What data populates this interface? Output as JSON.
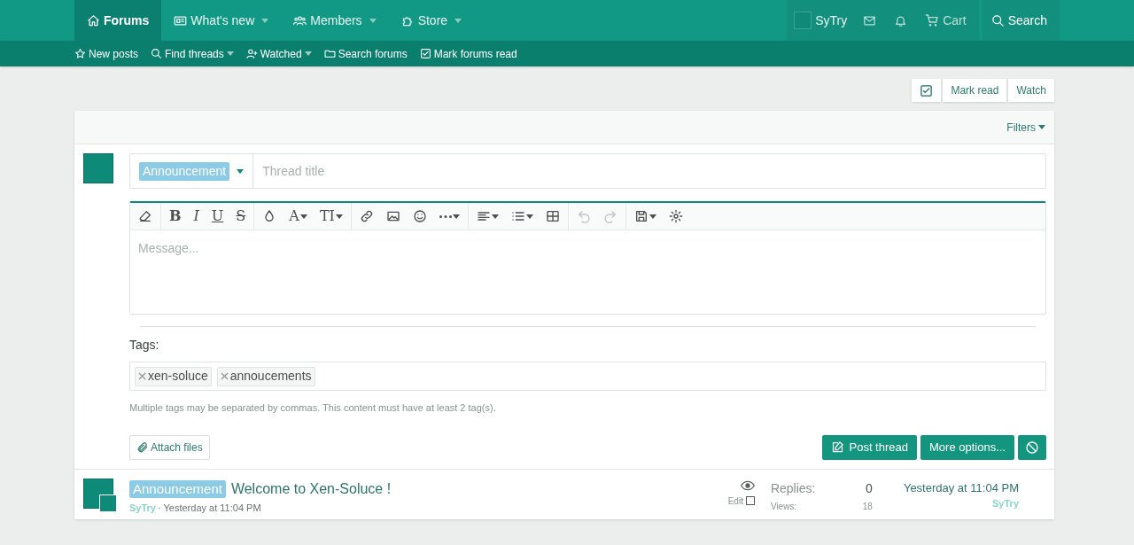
{
  "nav": {
    "tabs": [
      {
        "label": "Forums",
        "caret": false,
        "selected": true
      },
      {
        "label": "What's new",
        "caret": true,
        "selected": false
      },
      {
        "label": "Members",
        "caret": true,
        "selected": false
      },
      {
        "label": "Store",
        "caret": true,
        "selected": false
      }
    ],
    "user": "SyTry",
    "cart": "Cart",
    "search": "Search"
  },
  "subnav": [
    {
      "label": "New posts",
      "caret": false
    },
    {
      "label": "Find threads",
      "caret": true
    },
    {
      "label": "Watched",
      "caret": true
    },
    {
      "label": "Search forums",
      "caret": false
    },
    {
      "label": "Mark forums read",
      "caret": false
    }
  ],
  "actions": {
    "mark_read": "Mark read",
    "watch": "Watch"
  },
  "filters": "Filters",
  "form": {
    "prefix": "Announcement",
    "title_placeholder": "Thread title",
    "toolbar": [
      [
        {
          "kind": "eraser"
        }
      ],
      [
        {
          "kind": "bold",
          "label": "B"
        },
        {
          "kind": "italic",
          "label": "I"
        },
        {
          "kind": "underline",
          "label": "U"
        },
        {
          "kind": "strike",
          "label": "S"
        }
      ],
      [
        {
          "kind": "drop"
        },
        {
          "kind": "letter",
          "label": "A",
          "caret": true
        },
        {
          "kind": "letter",
          "label": "TI",
          "caret": true
        }
      ],
      [
        {
          "kind": "link"
        },
        {
          "kind": "image"
        },
        {
          "kind": "smile"
        },
        {
          "kind": "dots",
          "caret": true
        }
      ],
      [
        {
          "kind": "align",
          "caret": true
        },
        {
          "kind": "list",
          "caret": true
        },
        {
          "kind": "table"
        }
      ],
      [
        {
          "kind": "undo",
          "disabled": true
        },
        {
          "kind": "redo",
          "disabled": true
        }
      ],
      [
        {
          "kind": "save",
          "caret": true
        },
        {
          "kind": "gear"
        }
      ]
    ],
    "message_placeholder": "Message...",
    "tags_label": "Tags:",
    "tags": [
      "xen-soluce",
      "annoucements"
    ],
    "hint": "Multiple tags may be separated by commas. This content must have at least 2 tag(s).",
    "attach": "Attach files",
    "post": "Post thread",
    "more": "More options..."
  },
  "thread": {
    "prefix": "Announcement",
    "title": "Welcome to Xen-Soluce !",
    "author": "SyTry",
    "date": "· Yesterday at 11:04 PM",
    "edit": "Edit",
    "edit_checked": false,
    "replies_label": "Replies:",
    "replies": "0",
    "views_label": "Views:",
    "views": "18",
    "last_date": "Yesterday at 11:04 PM",
    "last_user": "SyTry"
  }
}
